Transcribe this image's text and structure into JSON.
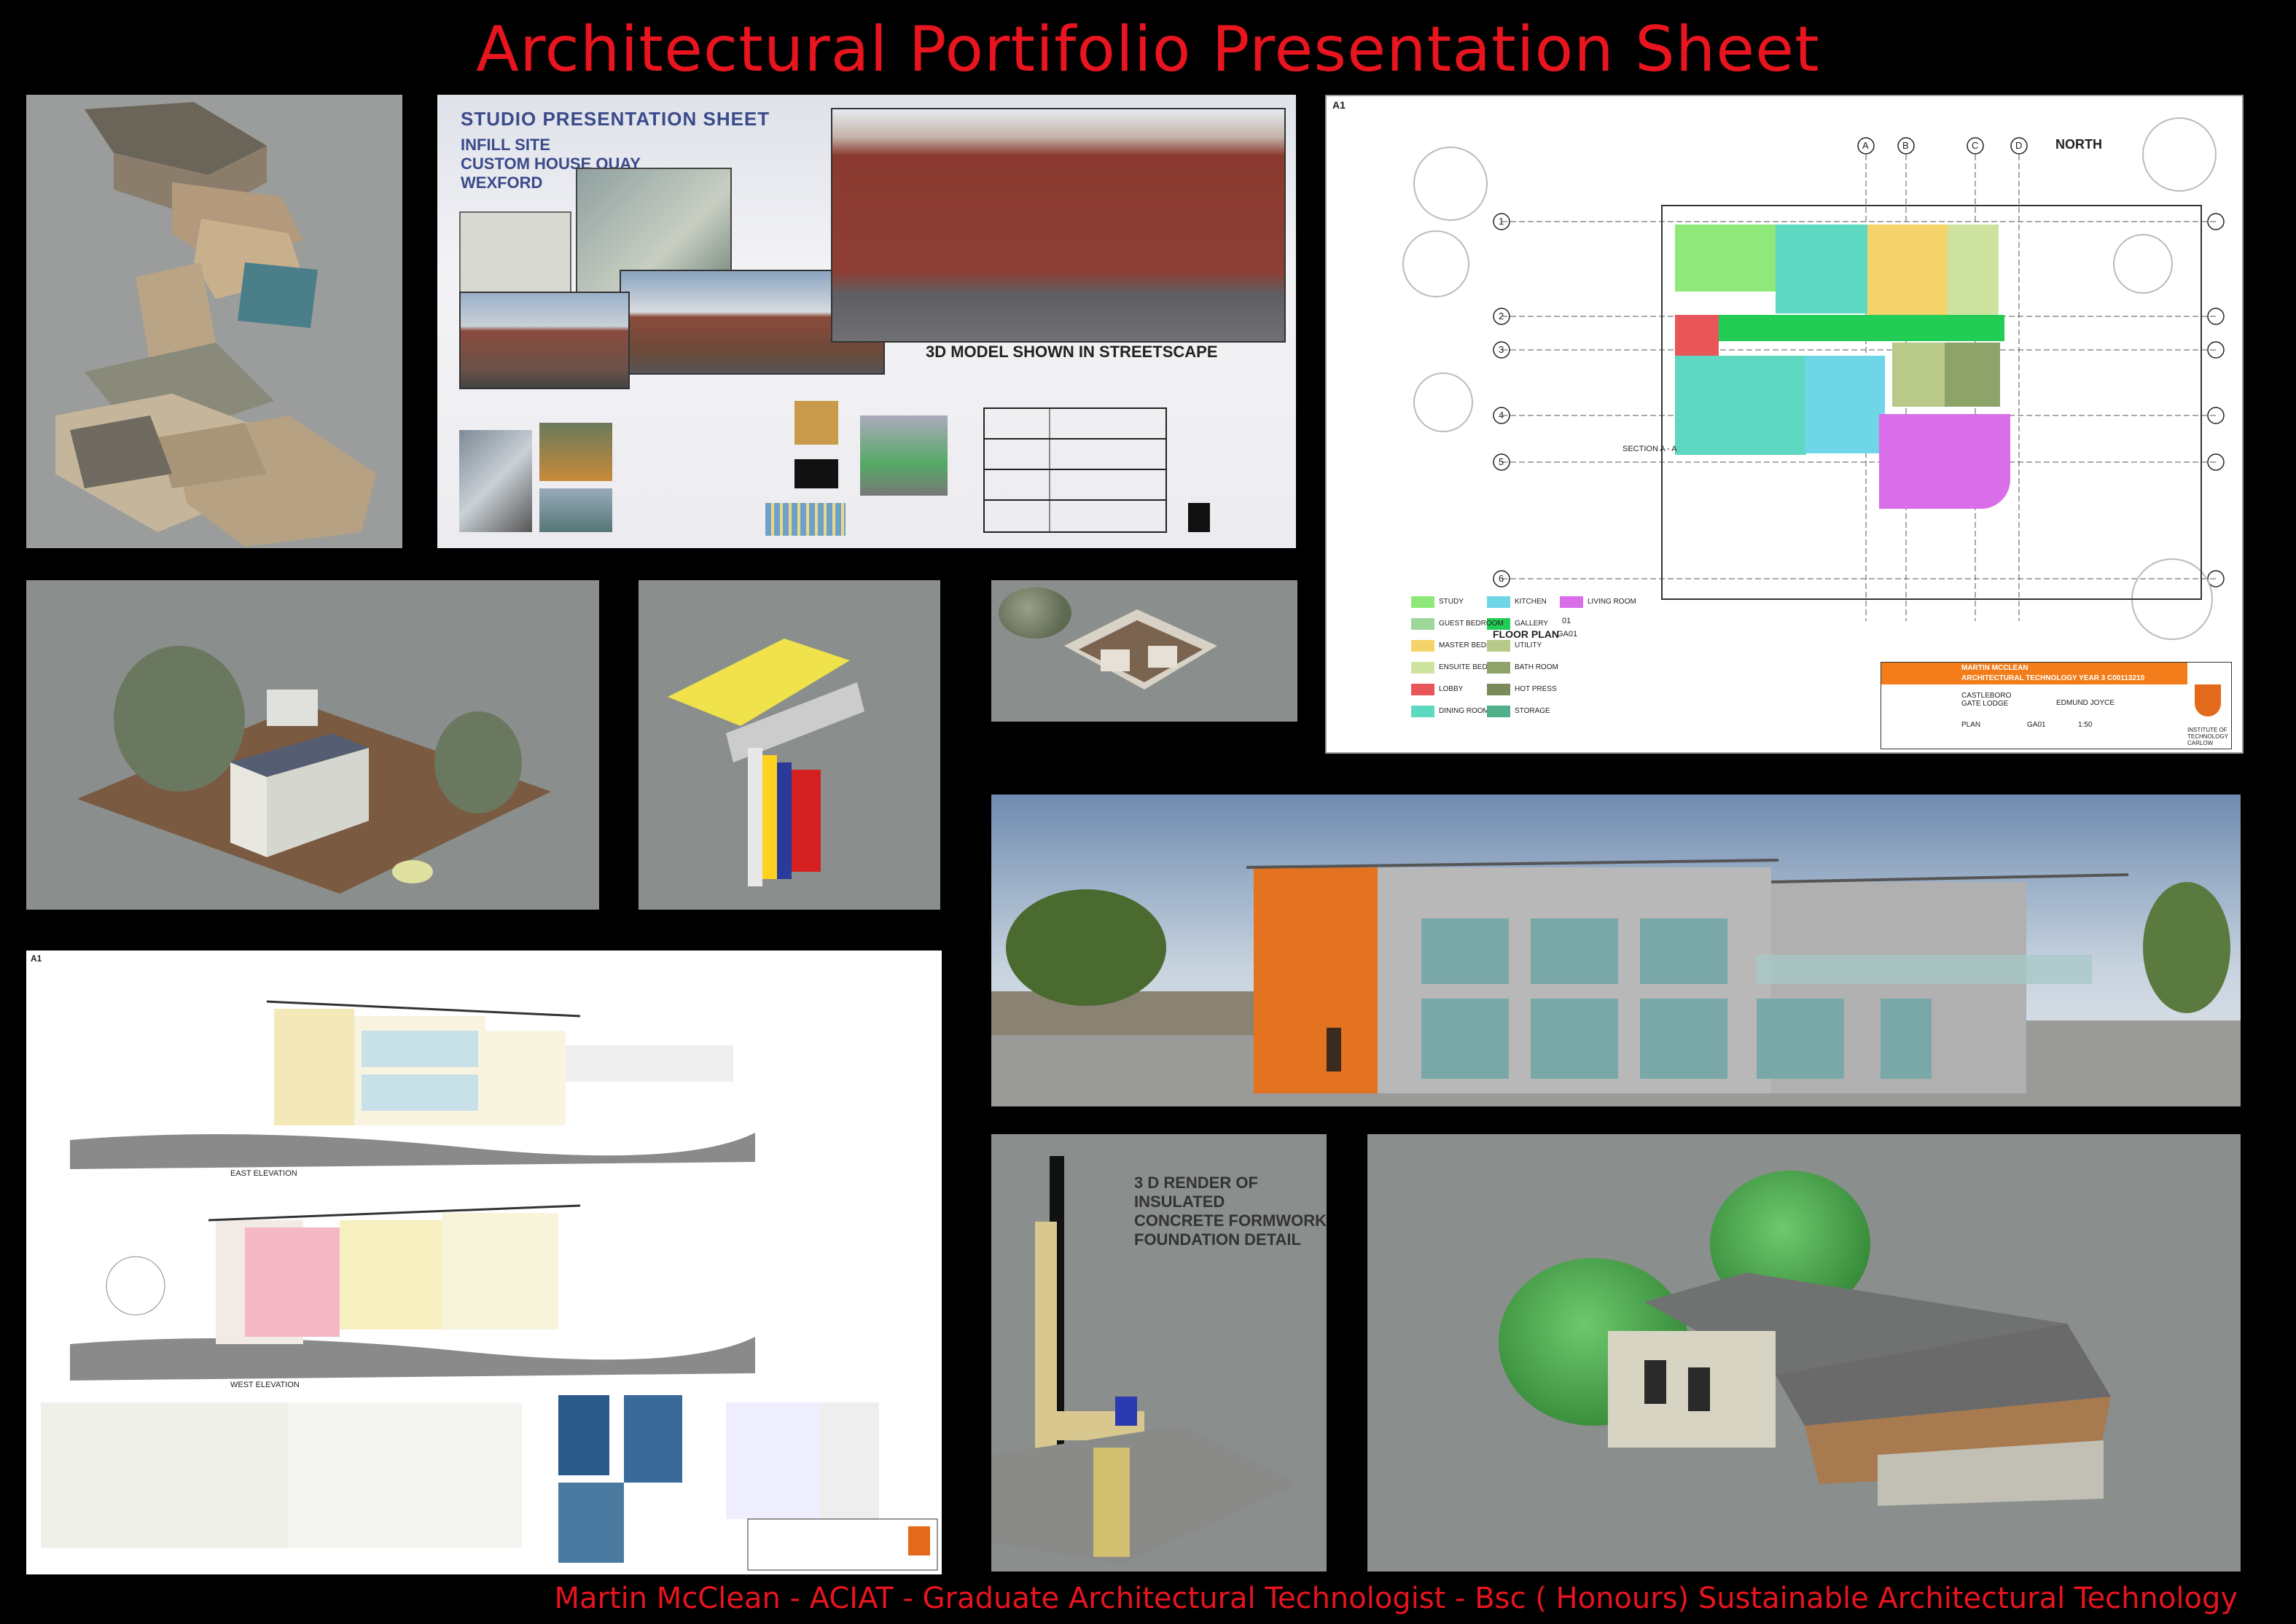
{
  "header": {
    "title": "Architectural Portifolio Presentation Sheet"
  },
  "footer": {
    "text": "Martin McClean - ACIAT - Graduate Architectural Technologist - Bsc ( Honours) Sustainable Architectural Technology"
  },
  "studio_sheet": {
    "heading": "STUDIO  PRESENTATION SHEET",
    "lines": [
      "INFILL SITE",
      "CUSTOM HOUSE QUAY",
      "WEXFORD"
    ],
    "streetscape_caption": "3D MODEL SHOWN IN STREETSCAPE"
  },
  "floor_plan": {
    "sheet_size": "A1",
    "north_label": "NORTH",
    "grid_cols": [
      "A",
      "B",
      "C",
      "D"
    ],
    "grid_rows": [
      "1",
      "2",
      "3",
      "4",
      "5",
      "6"
    ],
    "plan_title": "FLOOR PLAN",
    "plan_number": "01",
    "plan_sheet": "GA01",
    "section_label": "SECTION A - A",
    "title_block": {
      "name": "MARTIN MCCLEAN",
      "course": "ARCHITECTURAL TECHNOLOGY YEAR 3   C00113210",
      "project": "CASTLEBORO GATE LODGE",
      "client": "EDMUND JOYCE",
      "drawing": "PLAN",
      "number": "GA01",
      "scale": "1:50",
      "institute": "INSTITUTE OF TECHNOLOGY CARLOW"
    },
    "legend": [
      "STUDY",
      "KITCHEN",
      "LIVING ROOM",
      "MASTER BEDROOM",
      "GALLERY",
      "GUEST BEDROOM",
      "UTILITY",
      "ENSUITE BEDROOM",
      "BATH ROOM",
      "LOBBY",
      "HOT PRESS",
      "DINING ROOM",
      "STORAGE"
    ],
    "legend_colors": {
      "study": "#8fe87a",
      "kitchen": "#6fd6e8",
      "living_room": "#d96ee8",
      "master_bedroom": "#f3d36a",
      "gallery": "#22cc55",
      "guest_bedroom": "#9ed79a",
      "utility": "#b8c98a",
      "ensuite_bedroom": "#cfe3a0",
      "bath_room": "#8ea36a",
      "lobby": "#e8565a",
      "hot_press": "#7a8a5a",
      "dining_room": "#5ed8c0",
      "storage": "#4fb08a"
    }
  },
  "elevation_sheet": {
    "sheet_size": "A1",
    "east_label": "EAST ELEVATION",
    "west_label": "WEST ELEVATION"
  },
  "formwork_render": {
    "caption": [
      "3 D RENDER OF INSULATED",
      "CONCRETE FORMWORK",
      "FOUNDATION DETAIL"
    ]
  }
}
